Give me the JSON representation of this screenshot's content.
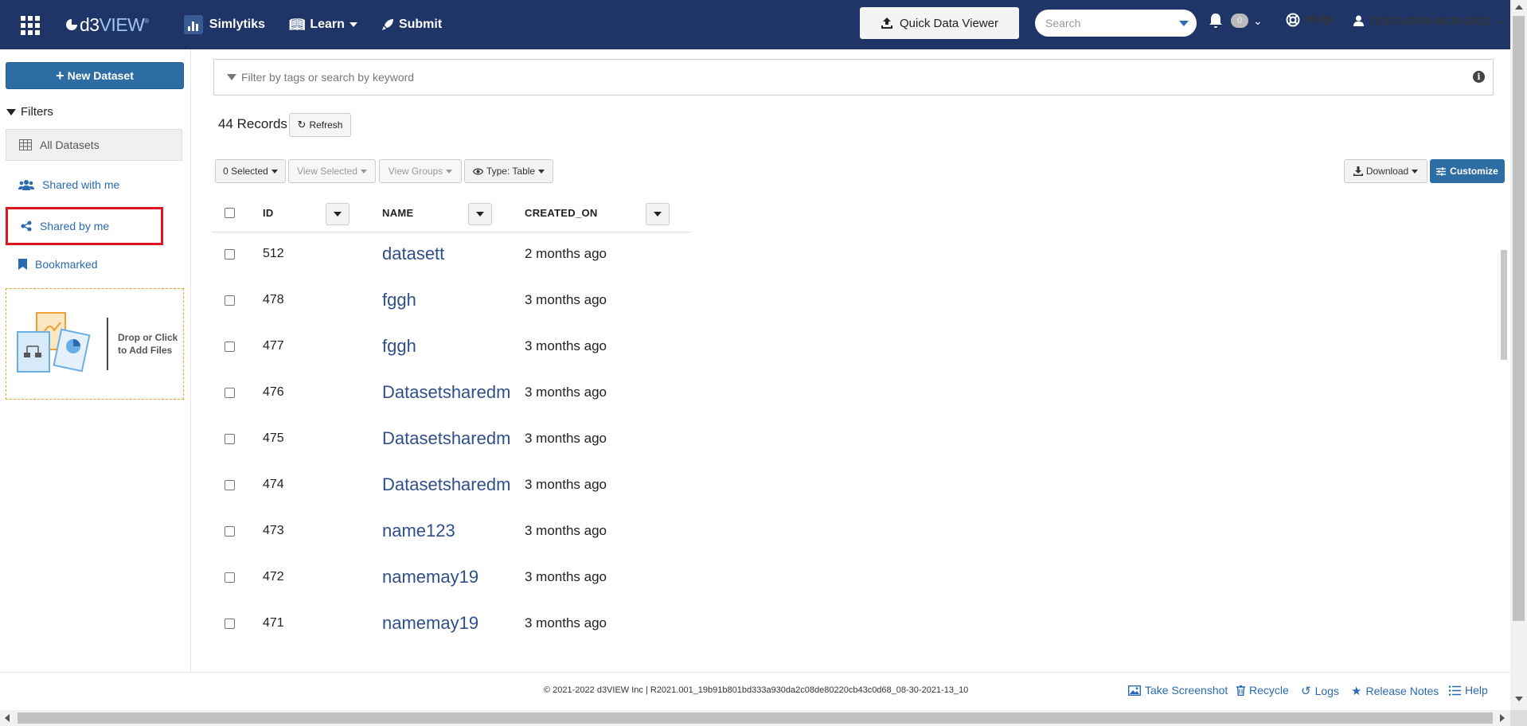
{
  "nav": {
    "simlytiks_label": "Simlytiks",
    "learn_label": "Learn",
    "submit_label": "Submit",
    "quick_data_viewer_label": "Quick Data Viewer",
    "search_placeholder": "Search",
    "notification_count": "0",
    "help_label": "Help",
    "user_label": "TEST.USER-08-30-2021"
  },
  "sidebar": {
    "new_dataset_label": "New Dataset",
    "filters_label": "Filters",
    "items": [
      {
        "label": "All Datasets",
        "icon": "table-icon"
      },
      {
        "label": "Shared with me",
        "icon": "users-icon"
      },
      {
        "label": "Shared by me",
        "icon": "share-icon"
      },
      {
        "label": "Bookmarked",
        "icon": "bookmark-icon"
      }
    ],
    "dropzone_line1": "Drop or Click",
    "dropzone_line2": "to Add Files"
  },
  "main": {
    "filter_placeholder": "Filter by tags or search by keyword",
    "records_label": "44 Records",
    "refresh_label": "Refresh",
    "toolbar": {
      "selected_label": "0 Selected",
      "view_selected_label": "View Selected",
      "view_groups_label": "View Groups",
      "type_label": "Type: Table",
      "download_label": "Download",
      "customize_label": "Customize"
    },
    "columns": [
      "ID",
      "NAME",
      "CREATED_ON"
    ],
    "rows": [
      {
        "id": "512",
        "name": "datasett",
        "created_on": "2 months ago"
      },
      {
        "id": "478",
        "name": "fggh",
        "created_on": "3 months ago"
      },
      {
        "id": "477",
        "name": "fggh",
        "created_on": "3 months ago"
      },
      {
        "id": "476",
        "name": "Datasetsharedm",
        "created_on": "3 months ago"
      },
      {
        "id": "475",
        "name": "Datasetsharedm",
        "created_on": "3 months ago"
      },
      {
        "id": "474",
        "name": "Datasetsharedm",
        "created_on": "3 months ago"
      },
      {
        "id": "473",
        "name": "name123",
        "created_on": "3 months ago"
      },
      {
        "id": "472",
        "name": "namemay19",
        "created_on": "3 months ago"
      },
      {
        "id": "471",
        "name": "namemay19",
        "created_on": "3 months ago"
      }
    ]
  },
  "footer": {
    "copyright": "© 2021-2022 d3VIEW Inc | R2021.001_19b91b801bd333a930da2c08de80220cb43c0d68_08-30-2021-13_10",
    "take_screenshot_label": "Take Screenshot",
    "recycle_label": "Recycle",
    "logs_label": "Logs",
    "release_notes_label": "Release Notes",
    "help_label": "Help"
  },
  "colors": {
    "navbar": "#1f3567",
    "primary_button": "#2e6da4",
    "link": "#2a6ab0",
    "highlight_box": "#e0141e"
  }
}
